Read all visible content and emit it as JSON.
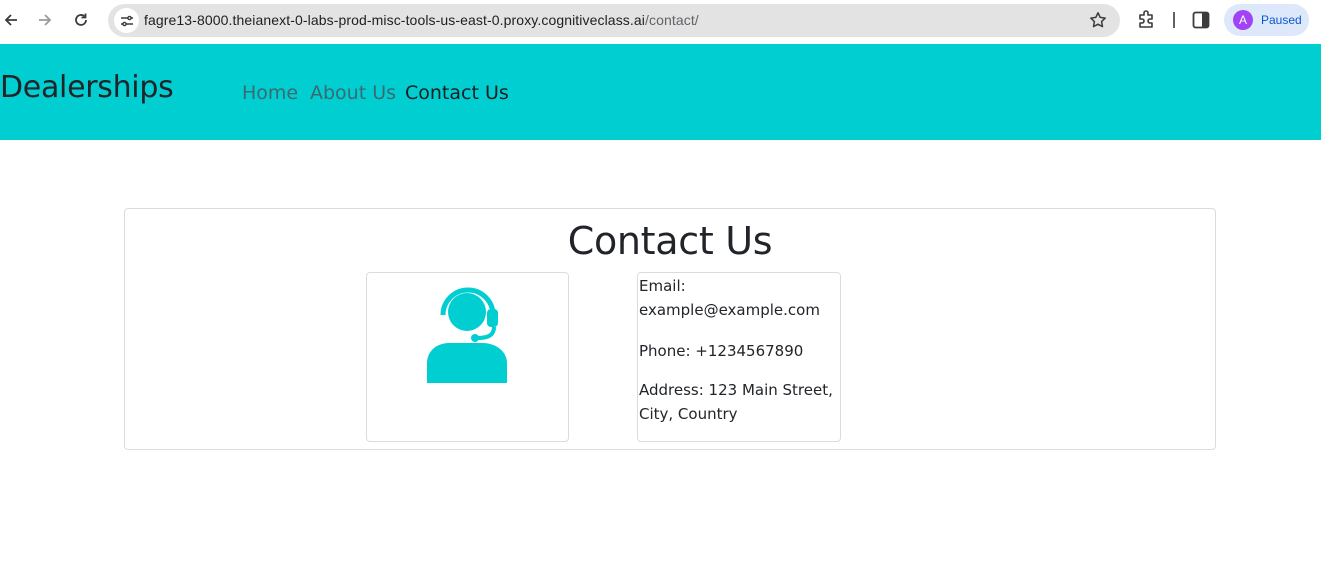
{
  "browser": {
    "url_host": "fagre13-8000.theianext-0-labs-prod-misc-tools-us-east-0.proxy.cognitiveclass.ai",
    "url_path": "/contact/",
    "profile_initial": "A",
    "profile_status": "Paused",
    "accent_color": "#a142f4"
  },
  "navbar": {
    "brand": "Dealerships",
    "links": [
      {
        "label": "Home",
        "active": false
      },
      {
        "label": "About Us",
        "active": false
      },
      {
        "label": "Contact Us",
        "active": true
      }
    ],
    "background_color": "#00ced1"
  },
  "contact": {
    "title": "Contact Us",
    "icon": "customer-support-headset-icon",
    "icon_color": "#00ced1",
    "email_line": "Email: example@example.com",
    "phone_line": "Phone: +1234567890",
    "address_line": "Address: 123 Main Street, City, Country"
  }
}
